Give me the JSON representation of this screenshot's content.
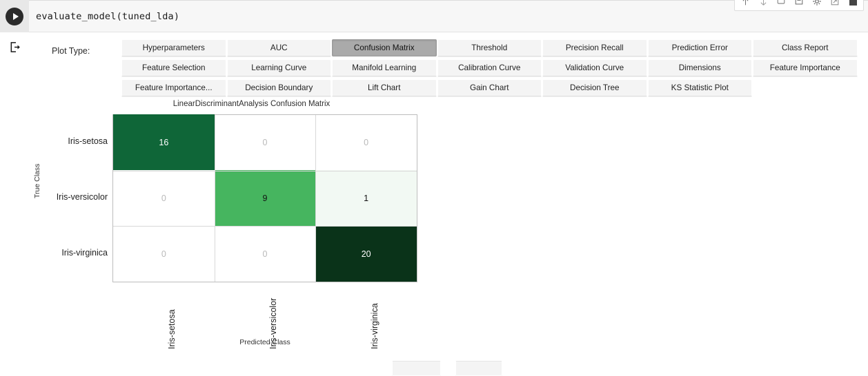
{
  "notebook": {
    "code": "evaluate_model(tuned_lda)",
    "run_icon": "play-icon",
    "toolbar_icons": [
      "move-up-icon",
      "move-down-icon",
      "duplicate-icon",
      "save-icon",
      "settings-icon",
      "export-icon",
      "stop-icon"
    ]
  },
  "rail": {
    "export_icon": "export-icon"
  },
  "widget": {
    "plot_type_label": "Plot Type:",
    "selected": "Confusion Matrix",
    "buttons": [
      "Hyperparameters",
      "AUC",
      "Confusion Matrix",
      "Threshold",
      "Precision Recall",
      "Prediction Error",
      "Class Report",
      "Feature Selection",
      "Learning Curve",
      "Manifold Learning",
      "Calibration Curve",
      "Validation Curve",
      "Dimensions",
      "Feature Importance",
      "Feature Importance...",
      "Decision Boundary",
      "Lift Chart",
      "Gain Chart",
      "Decision Tree",
      "KS Statistic Plot"
    ]
  },
  "chart_data": {
    "type": "heatmap",
    "title": "LinearDiscriminantAnalysis Confusion Matrix",
    "xlabel": "Predicted Class",
    "ylabel": "True Class",
    "categories": [
      "Iris-setosa",
      "Iris-versicolor",
      "Iris-virginica"
    ],
    "x_tick_labels": [
      "Iris-setosa",
      "Iris-versicolor",
      "Iris-virginica"
    ],
    "y_tick_labels": [
      "Iris-setosa",
      "Iris-versicolor",
      "Iris-virginica"
    ],
    "matrix": [
      [
        16,
        0,
        0
      ],
      [
        0,
        9,
        1
      ],
      [
        0,
        0,
        20
      ]
    ],
    "cell_colors": [
      [
        "#0f6638",
        "#ffffff",
        "#ffffff"
      ],
      [
        "#ffffff",
        "#46b55f",
        "#f2f9f3"
      ],
      [
        "#ffffff",
        "#ffffff",
        "#0a3319"
      ]
    ],
    "cell_text_colors": [
      [
        "#ffffff",
        "#b9b9b9",
        "#b9b9b9"
      ],
      [
        "#b9b9b9",
        "#111111",
        "#111111"
      ],
      [
        "#b9b9b9",
        "#b9b9b9",
        "#ffffff"
      ]
    ],
    "grid": true,
    "legend": "none",
    "colormap": "Greens"
  },
  "colors": {
    "selected_button_bg": "#aaaaaa",
    "button_bg": "#f4f4f4",
    "cmap_dark": "#0a3319",
    "cmap_mid": "#46b55f",
    "cmap_light": "#f2f9f3"
  }
}
